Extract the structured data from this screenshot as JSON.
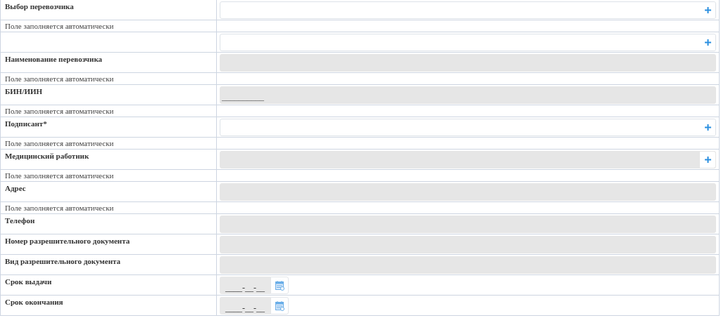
{
  "rows": [
    {
      "kind": "field",
      "label": "Выбор перевозчика",
      "disabled": false,
      "add_button": true
    },
    {
      "kind": "hint",
      "text": "Поле заполняется автоматически"
    },
    {
      "kind": "field",
      "disabled": false,
      "add_button": true
    },
    {
      "kind": "field",
      "label": "Наименование перевозчика",
      "disabled": true,
      "add_button": false
    },
    {
      "kind": "hint",
      "text": "Поле заполняется автоматически"
    },
    {
      "kind": "field",
      "label": "БИН/ИИН",
      "disabled": true,
      "add_button": false,
      "value": "__________"
    },
    {
      "kind": "hint",
      "text": "Поле заполняется автоматически"
    },
    {
      "kind": "field",
      "label": "Подписант*",
      "disabled": false,
      "add_button": true
    },
    {
      "kind": "hint",
      "text": "Поле заполняется автоматически"
    },
    {
      "kind": "field",
      "label": "Медицинский работник",
      "disabled": true,
      "add_button": true
    },
    {
      "kind": "hint",
      "text": "Поле заполняется автоматически"
    },
    {
      "kind": "field",
      "label": "Адрес",
      "disabled": true,
      "add_button": false
    },
    {
      "kind": "hint",
      "text": "Поле заполняется автоматически"
    },
    {
      "kind": "field",
      "label": "Телефон",
      "disabled": true,
      "add_button": false
    },
    {
      "kind": "field",
      "label": "Номер разрешительного документа",
      "disabled": true,
      "add_button": false
    },
    {
      "kind": "field",
      "label": "Вид разрешительного документа",
      "disabled": true,
      "add_button": false
    },
    {
      "kind": "date",
      "label": "Срок выдачи",
      "value": "____-__-__"
    },
    {
      "kind": "date",
      "label": "Срок окончания",
      "value": "____-__-__"
    }
  ]
}
